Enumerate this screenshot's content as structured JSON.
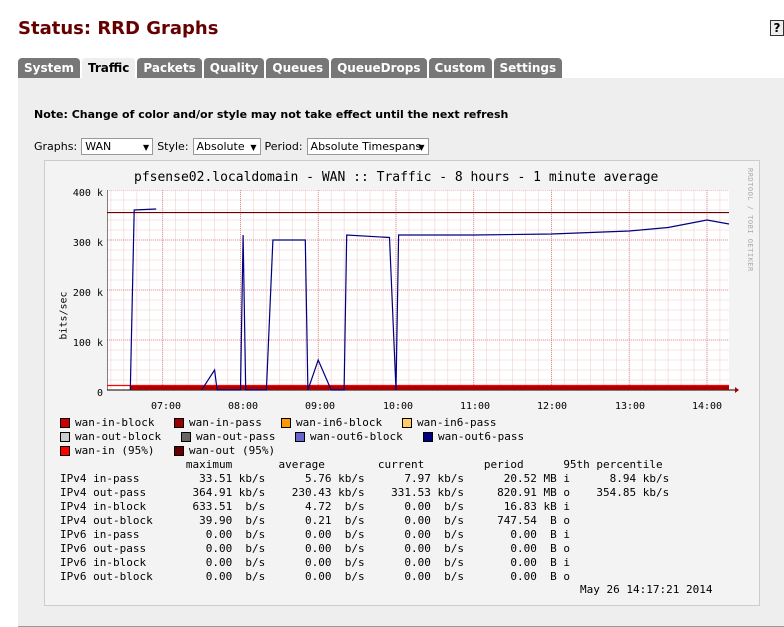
{
  "page": {
    "title": "Status: RRD Graphs",
    "help_icon": "?"
  },
  "tabs": [
    {
      "label": "System",
      "active": false
    },
    {
      "label": "Traffic",
      "active": true
    },
    {
      "label": "Packets",
      "active": false
    },
    {
      "label": "Quality",
      "active": false
    },
    {
      "label": "Queues",
      "active": false
    },
    {
      "label": "QueueDrops",
      "active": false
    },
    {
      "label": "Custom",
      "active": false
    },
    {
      "label": "Settings",
      "active": false
    }
  ],
  "note": "Note: Change of color and/or style may not take effect until the next refresh",
  "filters": {
    "graphs_label": "Graphs:",
    "graphs_value": "WAN",
    "style_label": "Style:",
    "style_value": "Absolute",
    "period_label": "Period:",
    "period_value": "Absolute Timespans"
  },
  "graph": {
    "title": "pfsense02.localdomain - WAN :: Traffic - 8 hours - 1 minute average",
    "side_label": "RRDTOOL / TOBI OETIKER",
    "ylabel": "bits/sec",
    "yticks": [
      "400 k",
      "300 k",
      "200 k",
      "100 k",
      "0"
    ],
    "xticks": [
      "07:00",
      "08:00",
      "09:00",
      "10:00",
      "11:00",
      "12:00",
      "13:00",
      "14:00"
    ],
    "timestamp": "May 26 14:17:21 2014"
  },
  "chart_data": {
    "type": "line",
    "title": "pfsense02.localdomain - WAN :: Traffic - 8 hours - 1 minute average",
    "xlabel": "",
    "ylabel": "bits/sec",
    "ylim": [
      0,
      400000
    ],
    "xlim": [
      "06:17",
      "14:17"
    ],
    "grid": true,
    "series": [
      {
        "name": "wan-out6-pass",
        "color": "#000080",
        "points": [
          [
            "06:35",
            0
          ],
          [
            "06:38",
            360000
          ],
          [
            "06:55",
            362000
          ],
          [
            "06:55",
            null
          ],
          [
            "07:30",
            0
          ],
          [
            "07:40",
            40000
          ],
          [
            "07:42",
            0
          ],
          [
            "08:00",
            0
          ],
          [
            "08:02",
            310000
          ],
          [
            "08:04",
            0
          ],
          [
            "08:20",
            0
          ],
          [
            "08:25",
            300000
          ],
          [
            "08:50",
            300000
          ],
          [
            "08:52",
            0
          ],
          [
            "09:00",
            60000
          ],
          [
            "09:10",
            0
          ],
          [
            "09:20",
            0
          ],
          [
            "09:22",
            310000
          ],
          [
            "09:55",
            305000
          ],
          [
            "10:00",
            0
          ],
          [
            "10:02",
            310000
          ],
          [
            "11:00",
            310000
          ],
          [
            "12:00",
            312000
          ],
          [
            "13:00",
            318000
          ],
          [
            "13:30",
            325000
          ],
          [
            "14:00",
            340000
          ],
          [
            "14:17",
            332000
          ]
        ]
      },
      {
        "name": "wan-in (95%)",
        "color": "#ff0000",
        "value": 8940
      },
      {
        "name": "wan-out (95%)",
        "color": "#660000",
        "value": 354850
      }
    ]
  },
  "legend": [
    {
      "label": "wan-in-block",
      "color": "#cc0000"
    },
    {
      "label": "wan-in-pass",
      "color": "#990000"
    },
    {
      "label": "wan-in6-block",
      "color": "#ff9900"
    },
    {
      "label": "wan-in6-pass",
      "color": "#ffcc66"
    },
    {
      "label": "wan-out-block",
      "color": "#cccccc"
    },
    {
      "label": "wan-out-pass",
      "color": "#666666"
    },
    {
      "label": "wan-out6-block",
      "color": "#6666cc"
    },
    {
      "label": "wan-out6-pass",
      "color": "#000080"
    },
    {
      "label": "wan-in (95%)",
      "color": "#ff0000"
    },
    {
      "label": "wan-out (95%)",
      "color": "#660000"
    }
  ],
  "stats": {
    "header": "                   maximum       average        current         period      95th percentile",
    "rows": [
      "IPv4 in-pass         33.51 kb/s      5.76 kb/s      7.97 kb/s      20.52 MB i      8.94 kb/s",
      "IPv4 out-pass       364.91 kb/s    230.43 kb/s    331.53 kb/s     820.91 MB o    354.85 kb/s",
      "IPv4 in-block       633.51  b/s      4.72  b/s      0.00  b/s      16.83 kB i",
      "IPv4 out-block       39.90  b/s      0.21  b/s      0.00  b/s     747.54  B o",
      "IPv6 in-pass          0.00  b/s      0.00  b/s      0.00  b/s       0.00  B i",
      "IPv6 out-pass         0.00  b/s      0.00  b/s      0.00  b/s       0.00  B o",
      "IPv6 in-block         0.00  b/s      0.00  b/s      0.00  b/s       0.00  B i",
      "IPv6 out-block        0.00  b/s      0.00  b/s      0.00  b/s       0.00  B o"
    ]
  }
}
